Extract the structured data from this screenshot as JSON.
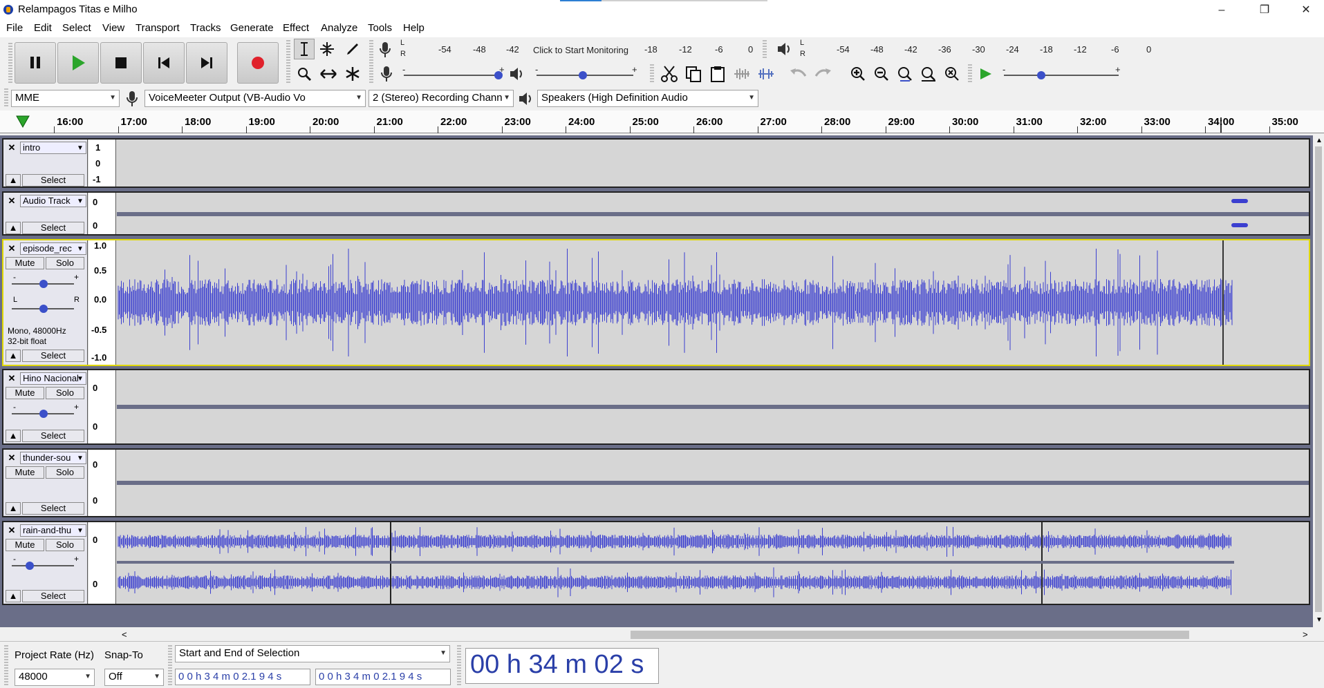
{
  "window": {
    "title": "Relampagos Titas e Milho",
    "min": "–",
    "max": "❐",
    "close": "✕"
  },
  "menu": [
    "File",
    "Edit",
    "Select",
    "View",
    "Transport",
    "Tracks",
    "Generate",
    "Effect",
    "Analyze",
    "Tools",
    "Help"
  ],
  "meters": {
    "record_labels": [
      "-54",
      "-48",
      "-42",
      "Click to Start Monitoring",
      "-18",
      "-12",
      "-6",
      "0"
    ],
    "play_labels": [
      "-54",
      "-48",
      "-42",
      "-36",
      "-30",
      "-24",
      "-18",
      "-12",
      "-6",
      "0"
    ],
    "L": "L",
    "R": "R"
  },
  "devices": {
    "host": "MME",
    "recording_device": "VoiceMeeter Output (VB-Audio Vo",
    "channels": "2 (Stereo) Recording Chann",
    "playback_device": "Speakers (High Definition Audio"
  },
  "ruler": [
    "16:00",
    "17:00",
    "18:00",
    "19:00",
    "20:00",
    "21:00",
    "22:00",
    "23:00",
    "24:00",
    "25:00",
    "26:00",
    "27:00",
    "28:00",
    "29:00",
    "30:00",
    "31:00",
    "32:00",
    "33:00",
    "34:00",
    "35:00"
  ],
  "tracks": [
    {
      "name": "intro",
      "select": "Select",
      "scale": [
        "1",
        "0",
        "-1"
      ]
    },
    {
      "name": "Audio Track",
      "select": "Select",
      "scale": [
        "0",
        "0"
      ]
    },
    {
      "name": "episode_rec",
      "mute": "Mute",
      "solo": "Solo",
      "select": "Select",
      "info": "Mono, 48000Hz",
      "bits": "32-bit float",
      "scale": [
        "1.0",
        "0.5",
        "0.0",
        "-0.5",
        "-1.0"
      ],
      "gain_minus": "-",
      "gain_plus": "+",
      "pan_l": "L",
      "pan_r": "R"
    },
    {
      "name": "Hino Nacional",
      "mute": "Mute",
      "solo": "Solo",
      "select": "Select",
      "scale": [
        "0",
        "0"
      ],
      "gain_minus": "-",
      "gain_plus": "+"
    },
    {
      "name": "thunder-sou",
      "mute": "Mute",
      "solo": "Solo",
      "select": "Select",
      "scale": [
        "0",
        "0"
      ]
    },
    {
      "name": "rain-and-thu",
      "mute": "Mute",
      "solo": "Solo",
      "select": "Select",
      "scale": [
        "0",
        "0"
      ],
      "gain_minus": "-",
      "gain_plus": "+"
    }
  ],
  "status": {
    "project_rate_label": "Project Rate (Hz)",
    "project_rate": "48000",
    "snap_label": "Snap-To",
    "snap": "Off",
    "selection_mode": "Start and End of Selection",
    "sel_start": "0 0 h 3 4 m 0 2.1 9 4 s",
    "sel_end": "0 0 h 3 4 m 0 2.1 9 4 s",
    "big_time": "00 h 34 m 02 s"
  },
  "colors": {
    "wave": "#3b3fd0",
    "record": "#e0212b",
    "play": "#2ba52b",
    "accent": "#3b50c9"
  }
}
